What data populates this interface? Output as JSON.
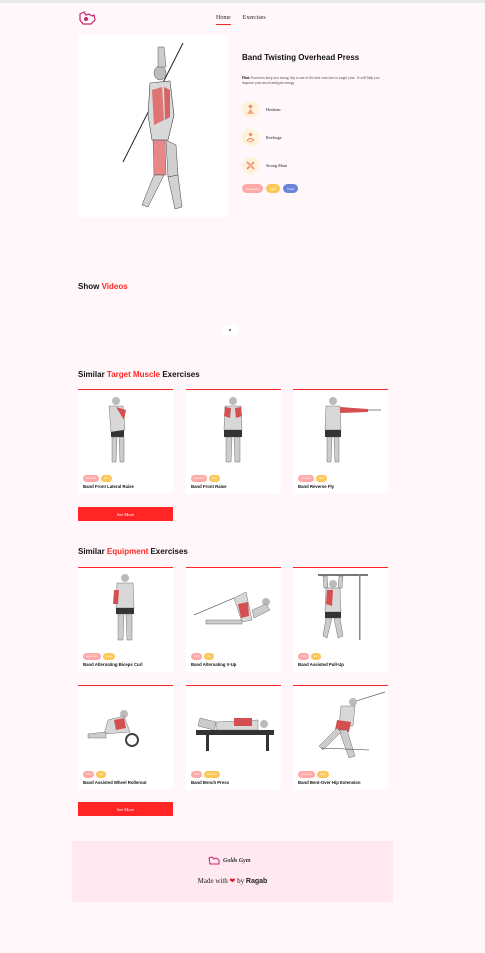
{
  "nav": {
    "home": "Home",
    "exercises": "Exercises"
  },
  "hero": {
    "title": "Band Twisting Overhead Press",
    "description_label": "Hint:",
    "description": "Exercises keep you strong. hip is one of the best exercises to target your . It will help you improve your mood and gain energy.",
    "details": [
      {
        "icon": "body-part-icon",
        "label": "Hexbran"
      },
      {
        "icon": "target-icon",
        "label": "Roebsige"
      },
      {
        "icon": "equipment-icon",
        "label": "Strong Main"
      }
    ],
    "badges": [
      "shoulders",
      "delts",
      "band"
    ]
  },
  "videos": {
    "prefix": "Show ",
    "highlight": "Videos"
  },
  "similar_target": {
    "prefix": "Similar ",
    "highlight": "Target Muscle",
    "suffix": " Exercises",
    "cards": [
      {
        "name": "Band Front Lateral Raise",
        "badges": [
          "shoulders",
          "delts"
        ]
      },
      {
        "name": "Band Front Raise",
        "badges": [
          "shoulders",
          "delts"
        ]
      },
      {
        "name": "Band Reverse Fly",
        "badges": [
          "shoulders",
          "delts"
        ]
      }
    ],
    "see_more": "See More"
  },
  "similar_equipment": {
    "prefix": "Similar ",
    "highlight": "Equipment",
    "suffix": " Exercises",
    "cards": [
      {
        "name": "Band Alternating Biceps Curl",
        "badges": [
          "upper arms",
          "biceps"
        ]
      },
      {
        "name": "Band Alternating V-Up",
        "badges": [
          "waist",
          "abs"
        ]
      },
      {
        "name": "Band Assisted Pull-Up",
        "badges": [
          "back",
          "lats"
        ]
      },
      {
        "name": "Band Assisted Wheel Rollerout",
        "badges": [
          "waist",
          "abs"
        ]
      },
      {
        "name": "Band Bench Press",
        "badges": [
          "chest",
          "pectorals"
        ]
      },
      {
        "name": "Band Bent-Over Hip Extension",
        "badges": [
          "upper legs",
          "glutes"
        ]
      }
    ],
    "see_more": "See More"
  },
  "footer": {
    "logo_text": "Golds Gym",
    "made_with": "Made with",
    "by": "by",
    "author": "Ragab"
  },
  "colors": {
    "accent": "#ff2625",
    "pink_badge": "#ffa9a9",
    "yellow_badge": "#fcc757",
    "blue_badge": "#6b84d9",
    "bg": "#fff7f9"
  }
}
